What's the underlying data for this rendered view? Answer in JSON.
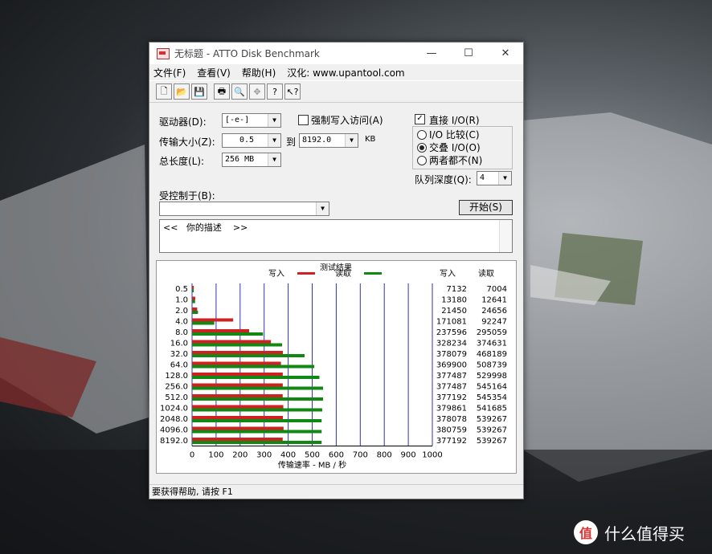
{
  "window": {
    "title": "无标题 - ATTO Disk Benchmark",
    "minimize": "—",
    "maximize": "☐",
    "close": "✕"
  },
  "menu": [
    "文件(F)",
    "查看(V)",
    "帮助(H)",
    "汉化: www.upantool.com"
  ],
  "toolbar": [
    "new",
    "open",
    "save",
    "print",
    "preview",
    "move",
    "help",
    "context-help"
  ],
  "form": {
    "drive_label": "驱动器(D):",
    "drive_value": "[-e-]",
    "force_write_label": "强制写入访问(A)",
    "force_write_checked": false,
    "direct_io_label": "直接 I/O(R)",
    "direct_io_checked": true,
    "transfer_label": "传输大小(Z):",
    "transfer_from": "0.5",
    "to_label": "到",
    "transfer_to": "8192.0",
    "kb_label": "KB",
    "io_compare": "I/O 比较(C)",
    "overlapped_io": "交叠 I/O(O)",
    "neither": "两者都不(N)",
    "io_selected": "overlapped",
    "total_length_label": "总长度(L):",
    "total_length_value": "256 MB",
    "queue_depth_label": "队列深度(Q):",
    "queue_depth_value": "4",
    "controlled_by_label": "受控制于(B):",
    "controlled_by_value": "",
    "start_button": "开始(S)",
    "description": "<<   你的描述    >>"
  },
  "results": {
    "title": "测试结果",
    "write_legend": "写入",
    "read_legend": "读取",
    "write_col": "写入",
    "read_col": "读取",
    "xlabel": "传输速率 - MB / 秒",
    "colors": {
      "write": "#cc2222",
      "read": "#118811",
      "grid": "#3333aa"
    }
  },
  "chart_data": {
    "type": "bar",
    "orientation": "horizontal",
    "categories": [
      "0.5",
      "1.0",
      "2.0",
      "4.0",
      "8.0",
      "16.0",
      "32.0",
      "64.0",
      "128.0",
      "256.0",
      "512.0",
      "1024.0",
      "2048.0",
      "4096.0",
      "8192.0"
    ],
    "series": [
      {
        "name": "写入",
        "values": [
          7132,
          13180,
          21450,
          171081,
          237596,
          328234,
          378079,
          369900,
          377487,
          377487,
          377192,
          379861,
          378078,
          380759,
          377192
        ]
      },
      {
        "name": "读取",
        "values": [
          7004,
          12641,
          24656,
          92247,
          295059,
          374631,
          468189,
          508739,
          529998,
          545164,
          545354,
          541685,
          539267,
          539267,
          539267
        ]
      }
    ],
    "xticks": [
      "0",
      "100",
      "200",
      "300",
      "400",
      "500",
      "600",
      "700",
      "800",
      "900",
      "1000"
    ],
    "xlim": [
      0,
      1000
    ],
    "xlabel": "传输速率 - MB / 秒",
    "grid": true
  },
  "statusbar": "要获得帮助, 请按 F1",
  "watermark": {
    "badge": "值",
    "text": "什么值得买"
  }
}
